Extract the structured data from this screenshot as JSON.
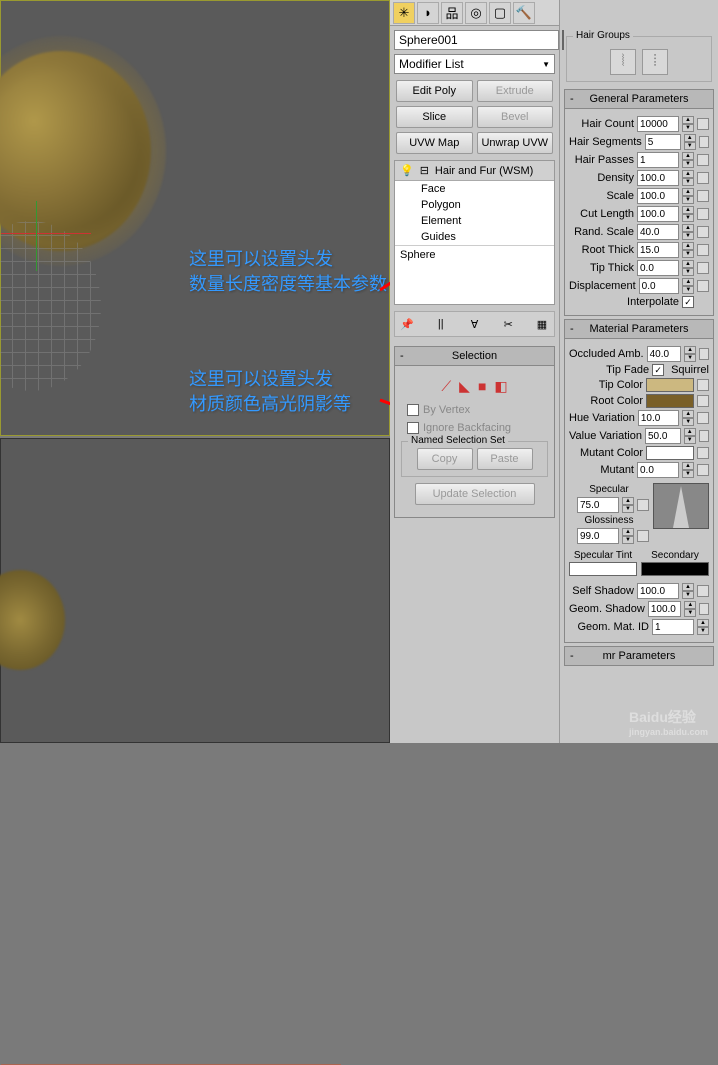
{
  "object_name": "Sphere001",
  "modifier_dropdown": "Modifier List",
  "mod_buttons": {
    "edit_poly": "Edit Poly",
    "extrude": "Extrude",
    "slice": "Slice",
    "bevel": "Bevel",
    "uvw_map": "UVW Map",
    "unwrap": "Unwrap UVW"
  },
  "stack": {
    "top": "Hair and Fur (WSM)",
    "items": [
      "Face",
      "Polygon",
      "Element",
      "Guides"
    ],
    "base": "Sphere"
  },
  "selection": {
    "title": "Selection",
    "by_vertex": "By Vertex",
    "ignore_backfacing": "Ignore Backfacing",
    "named_set": "Named Selection Set",
    "copy": "Copy",
    "paste": "Paste",
    "update": "Update Selection"
  },
  "hair_groups": {
    "title": "Hair Groups"
  },
  "general": {
    "title": "General Parameters",
    "rows": [
      {
        "label": "Hair Count",
        "value": "10000"
      },
      {
        "label": "Hair Segments",
        "value": "5"
      },
      {
        "label": "Hair Passes",
        "value": "1"
      },
      {
        "label": "Density",
        "value": "100.0"
      },
      {
        "label": "Scale",
        "value": "100.0"
      },
      {
        "label": "Cut Length",
        "value": "100.0"
      },
      {
        "label": "Rand. Scale",
        "value": "40.0"
      },
      {
        "label": "Root Thick",
        "value": "15.0"
      },
      {
        "label": "Tip Thick",
        "value": "0.0"
      },
      {
        "label": "Displacement",
        "value": "0.0"
      }
    ],
    "interpolate": "Interpolate"
  },
  "material": {
    "title": "Material Parameters",
    "occluded": {
      "label": "Occluded Amb.",
      "value": "40.0"
    },
    "tip_fade": "Tip Fade",
    "squirrel": "Squirrel",
    "tip_color": "Tip Color",
    "root_color": "Root Color",
    "hue_var": {
      "label": "Hue Variation",
      "value": "10.0"
    },
    "val_var": {
      "label": "Value Variation",
      "value": "50.0"
    },
    "mutant_color": "Mutant Color",
    "mutant": {
      "label": "Mutant",
      "value": "0.0"
    },
    "specular": "Specular",
    "specular_val": "75.0",
    "glossiness": "Glossiness",
    "glossiness_val": "99.0",
    "spec_tint": "Specular Tint",
    "secondary": "Secondary",
    "self_shadow": {
      "label": "Self Shadow",
      "value": "100.0"
    },
    "geom_shadow": {
      "label": "Geom. Shadow",
      "value": "100.0"
    },
    "geom_mat": {
      "label": "Geom. Mat. ID",
      "value": "1"
    }
  },
  "mr_params": {
    "title": "mr Parameters"
  },
  "annotations": {
    "a1_l1": "这里可以设置头发",
    "a1_l2": "数量长度密度等基本参数",
    "a2_l1": "这里可以设置头发",
    "a2_l2": "材质颜色高光阴影等"
  },
  "watermark": {
    "main": "Baidu经验",
    "sub": "jingyan.baidu.com"
  }
}
